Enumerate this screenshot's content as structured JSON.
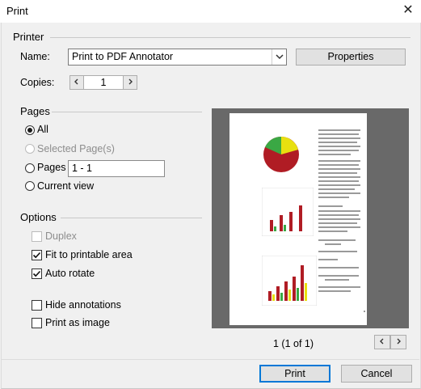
{
  "window": {
    "title": "Print"
  },
  "printer": {
    "group_label": "Printer",
    "name_label": "Name:",
    "name_value": "Print to PDF Annotator",
    "properties_label": "Properties",
    "copies_label": "Copies:",
    "copies_value": "1"
  },
  "pages": {
    "group_label": "Pages",
    "all_label": "All",
    "selected_label": "Selected Page(s)",
    "pages_label": "Pages",
    "pages_value": "1 - 1",
    "current_label": "Current view",
    "selected_option": "All"
  },
  "options": {
    "group_label": "Options",
    "duplex_label": "Duplex",
    "fit_label": "Fit to printable area",
    "rotate_label": "Auto rotate",
    "hide_label": "Hide annotations",
    "image_label": "Print as image",
    "duplex_checked": false,
    "fit_checked": true,
    "rotate_checked": true,
    "hide_checked": false,
    "image_checked": false
  },
  "preview": {
    "page_indicator": "1 (1 of 1)"
  },
  "footer": {
    "print_label": "Print",
    "cancel_label": "Cancel"
  },
  "icons": {
    "close": "close-icon",
    "chevron": "chevron-down-icon",
    "prev": "chevron-left-icon",
    "next": "chevron-right-icon",
    "check": "checkmark-icon"
  }
}
